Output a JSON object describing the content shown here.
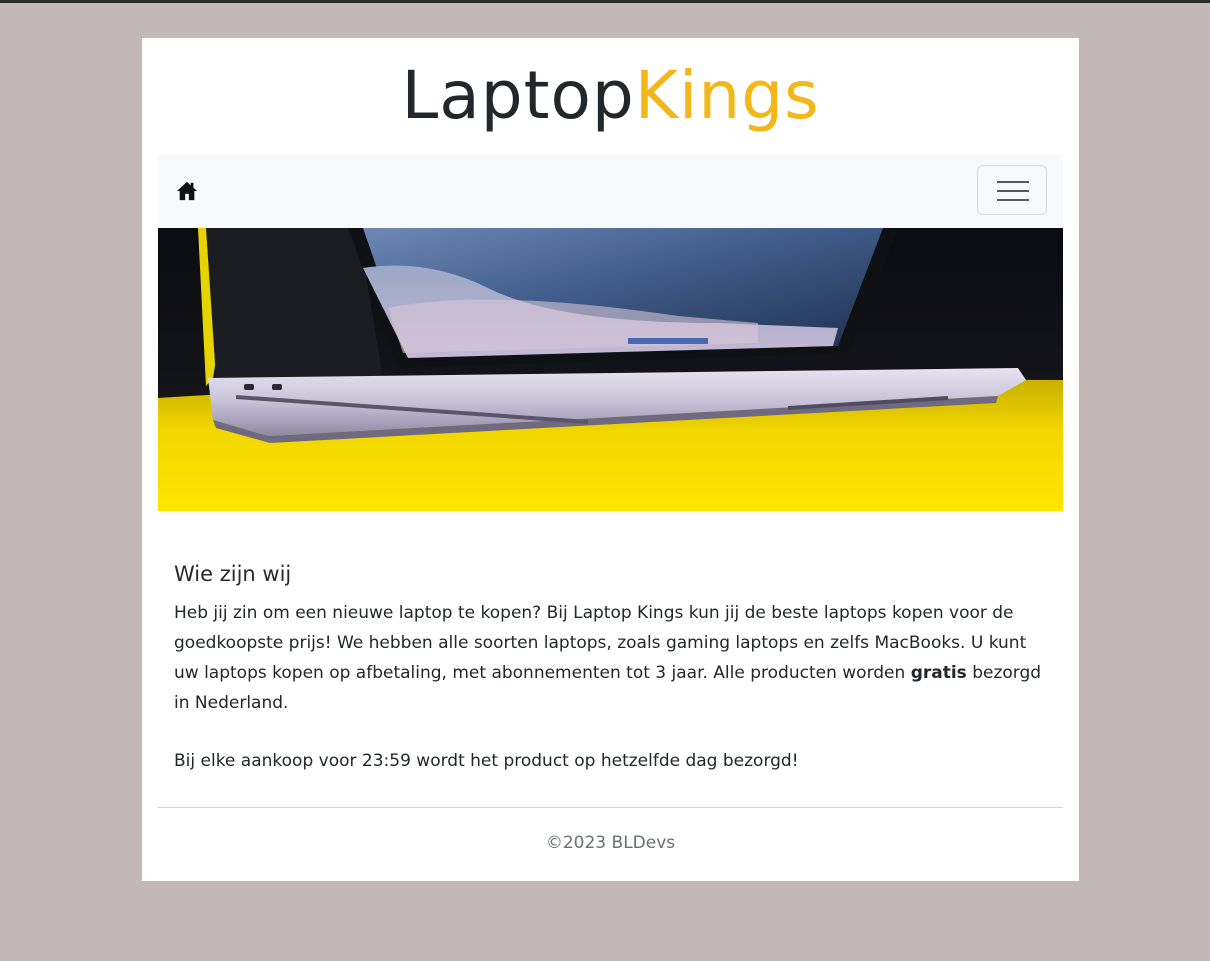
{
  "brand": {
    "part1": "Laptop",
    "part2": "Kings"
  },
  "navbar": {
    "home_icon": "home-icon",
    "toggler_icon": "hamburger-icon"
  },
  "hero": {
    "description": "laptop-banner-image"
  },
  "about": {
    "heading": "Wie zijn wij",
    "p1_before": "Heb jij zin om een nieuwe laptop te kopen? Bij Laptop Kings kun jij de beste laptops kopen voor de goedkoopste prijs! We hebben alle soorten laptops, zoals gaming laptops en zelfs MacBooks. U kunt uw laptops kopen op afbetaling, met abonnementen tot 3 jaar. Alle producten worden ",
    "p1_bold": "gratis",
    "p1_after": " bezorgd in Nederland.",
    "p2": "Bij elke aankoop voor 23:59 wordt het product op hetzelfde dag bezorgd!"
  },
  "footer": {
    "copyright": "©2023 BLDevs"
  },
  "colors": {
    "background": "#c1b8b7",
    "accent": "#f4b71a",
    "navbar": "#f8f9fa"
  }
}
